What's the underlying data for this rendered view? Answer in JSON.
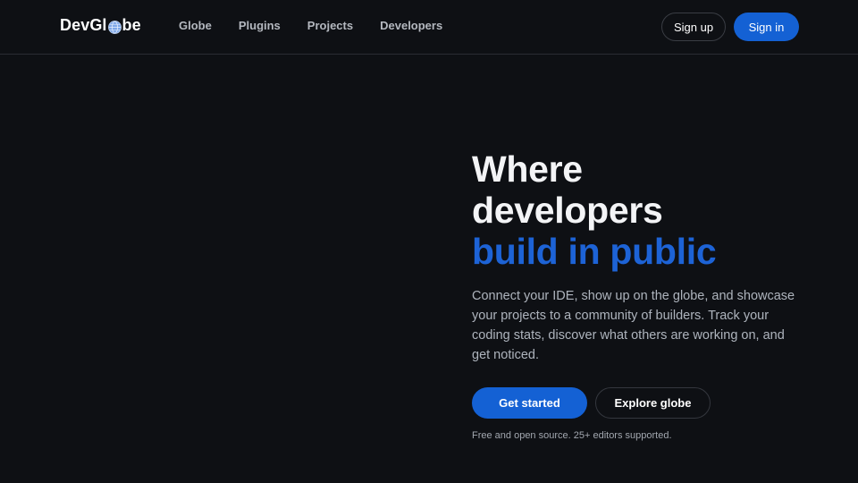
{
  "brand": {
    "prefix": "DevGl",
    "globe_icon": "globe-icon",
    "suffix": "be",
    "accent_color": "#1461d4"
  },
  "nav": {
    "links": [
      {
        "label": "Globe"
      },
      {
        "label": "Plugins"
      },
      {
        "label": "Projects"
      },
      {
        "label": "Developers"
      }
    ],
    "signup_label": "Sign up",
    "signin_label": "Sign in"
  },
  "hero": {
    "title_line1": "Where",
    "title_line2": "developers",
    "title_line3": "build in public",
    "description": "Connect your IDE, show up on the globe, and showcase your projects to a community of builders. Track your coding stats, discover what others are working on, and get noticed.",
    "primary_cta": "Get started",
    "secondary_cta": "Explore globe",
    "footnote": "Free and open source. 25+ editors supported."
  },
  "colors": {
    "background": "#0e1014",
    "primary": "#1461d4",
    "title_accent": "#1d63d6"
  }
}
